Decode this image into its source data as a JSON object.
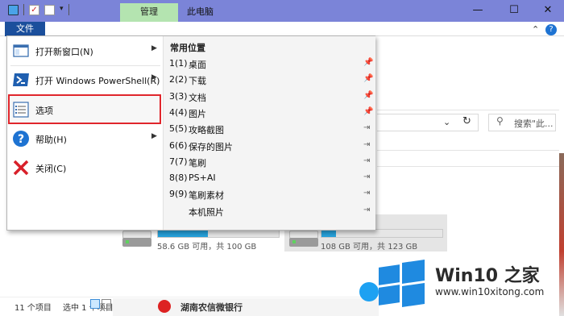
{
  "window": {
    "title": "此电脑",
    "context_tab": "管理",
    "file_tab": "文件"
  },
  "window_controls": {
    "minimize": "—",
    "maximize": "☐",
    "close": "✕",
    "collapse_ribbon": "⌃",
    "help": "?"
  },
  "file_menu": {
    "items": [
      {
        "label": "打开新窗口(N)",
        "icon": "new-window-icon",
        "has_submenu": true
      },
      {
        "label": "打开 Windows PowerShell(R)",
        "icon": "powershell-icon",
        "has_submenu": true
      },
      {
        "label": "选项",
        "icon": "options-icon",
        "has_submenu": false,
        "highlighted": true
      },
      {
        "label": "帮助(H)",
        "icon": "help-icon",
        "has_submenu": true
      },
      {
        "label": "关闭(C)",
        "icon": "close-icon",
        "has_submenu": false
      }
    ],
    "recent_header": "常用位置",
    "recent": [
      {
        "num": "1(1)",
        "name": "桌面",
        "pinned": true
      },
      {
        "num": "2(2)",
        "name": "下载",
        "pinned": true
      },
      {
        "num": "3(3)",
        "name": "文档",
        "pinned": true
      },
      {
        "num": "4(4)",
        "name": "图片",
        "pinned": true
      },
      {
        "num": "5(5)",
        "name": "攻略截图",
        "pinned": false
      },
      {
        "num": "6(6)",
        "name": "保存的图片",
        "pinned": false
      },
      {
        "num": "7(7)",
        "name": "笔刷",
        "pinned": false
      },
      {
        "num": "8(8)",
        "name": "PS+AI",
        "pinned": false
      },
      {
        "num": "9(9)",
        "name": "笔刷素材",
        "pinned": false
      },
      {
        "num": "",
        "name": "本机照片",
        "pinned": false
      }
    ]
  },
  "search": {
    "placeholder": "搜索\"此...",
    "refresh_icon": "↻"
  },
  "drives": [
    {
      "text": "58.6 GB 可用，共 100 GB",
      "used_fraction": 0.414
    },
    {
      "text": "108 GB 可用，共 123 GB",
      "used_fraction": 0.122
    }
  ],
  "status": {
    "count": "11 个项目",
    "selected": "选中 1 个项目"
  },
  "taskbar": {
    "text": "湖南农信微银行"
  },
  "watermark": {
    "title": "Win10 之家",
    "url": "www.win10xitong.com"
  },
  "colors": {
    "titlebar": "#7b84d8",
    "context_tab": "#b4e4b0",
    "file_tab": "#1b4f9c",
    "highlight_border": "#e0262c",
    "drive_bar": "#26a0da"
  }
}
